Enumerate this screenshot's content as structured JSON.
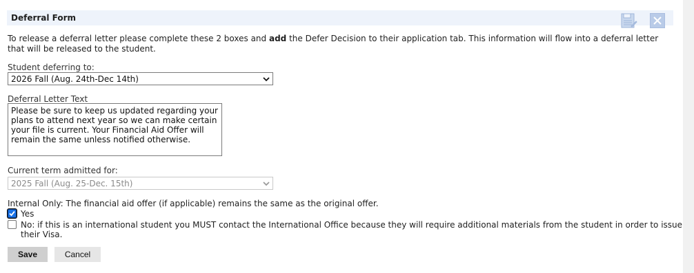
{
  "form": {
    "title": "Deferral Form",
    "intro_pre": "To release a deferral letter please complete these 2 boxes and ",
    "intro_bold": "add",
    "intro_post": " the Defer Decision to their application tab. This information will flow into a deferral letter that will be released to the student."
  },
  "deferring_to": {
    "label": "Student deferring to:",
    "selected": "2026 Fall (Aug. 24th-Dec 14th)"
  },
  "letter_text": {
    "label": "Deferral Letter Text",
    "value": "Please be sure to keep us updated regarding your plans to attend next year so we can make certain your file is current. Your Financial Aid Offer will remain the same unless notified otherwise."
  },
  "current_term": {
    "label": "Current term admitted for:",
    "selected": "2025 Fall (Aug. 25-Dec. 15th)"
  },
  "internal": {
    "label": "Internal Only: The financial aid offer (if applicable) remains the same as the original offer.",
    "yes_label": "Yes",
    "yes_checked": true,
    "no_label": "No: if this is an international student you MUST contact the International Office because they will require additional materials from the student in order to issue their Visa.",
    "no_checked": false
  },
  "buttons": {
    "save": "Save",
    "cancel": "Cancel"
  },
  "icons": {
    "save": "save-form-icon",
    "close": "close-icon"
  },
  "colors": {
    "title_bar": "#eef3fb",
    "checkbox_checked": "#1a73e8",
    "close_button": "#b9cbe8"
  }
}
